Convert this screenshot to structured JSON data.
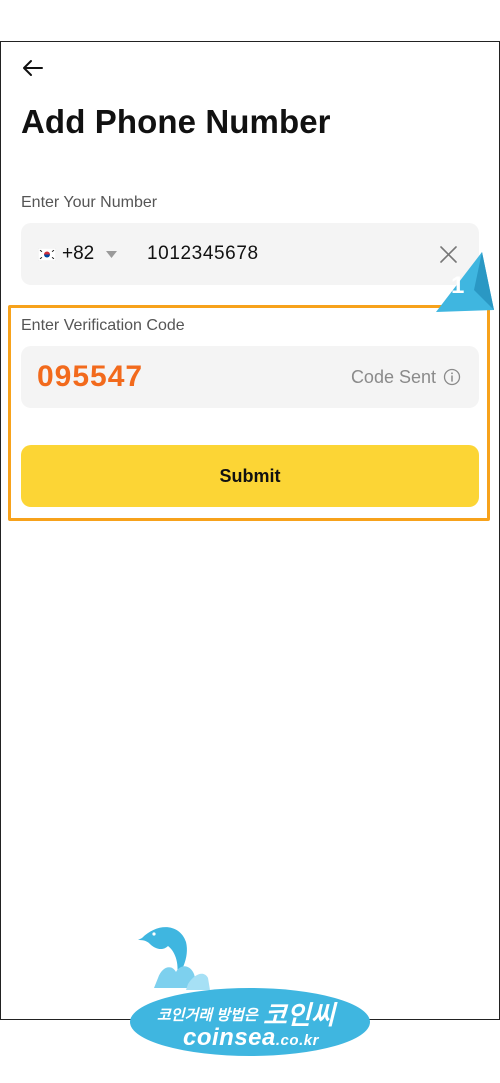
{
  "page": {
    "title": "Add Phone Number"
  },
  "phone": {
    "label": "Enter Your Number",
    "country_code": "+82",
    "country_flag": "kr-flag-icon",
    "value": "1012345678"
  },
  "verification": {
    "label": "Enter Verification Code",
    "code": "095547",
    "status": "Code Sent"
  },
  "submit": {
    "label": "Submit"
  },
  "annotation": {
    "step": "1",
    "highlight_color": "#f7a21b",
    "marker_color": "#3fb6e0"
  },
  "watermark": {
    "tagline": "코인거래 방법은",
    "brand": "코인씨",
    "domain": "coinsea",
    "tld": ".co.kr"
  },
  "colors": {
    "accent": "#fcd535",
    "code_text": "#f26a1c",
    "field_bg": "#f4f4f4"
  }
}
